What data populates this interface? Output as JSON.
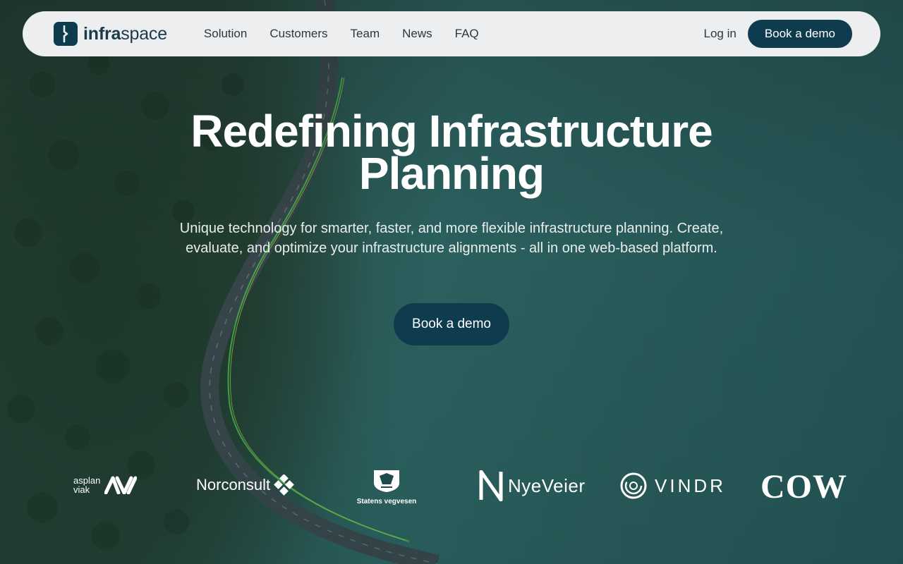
{
  "brand": {
    "name_bold": "infra",
    "name_regular": "space",
    "logo_icon": "infraspace-logo-icon",
    "primary_color": "#0f3b4e",
    "nav_bg": "#eceef0"
  },
  "nav": {
    "links": [
      "Solution",
      "Customers",
      "Team",
      "News",
      "FAQ"
    ],
    "login_label": "Log in",
    "cta_label": "Book a demo"
  },
  "hero": {
    "title_line1": "Redefining Infrastructure",
    "title_line2": "Planning",
    "subtitle": "Unique technology for smarter, faster, and more flexible infrastructure planning. Create, evaluate, and optimize your infrastructure alignments - all in one web-based platform.",
    "cta_label": "Book a demo",
    "background": "aerial-forest-road-lake-image"
  },
  "clients": {
    "asplan_viak": {
      "line1": "asplan",
      "line2": "viak",
      "icon": "asplan-viak-mark"
    },
    "norconsult": {
      "label": "Norconsult",
      "icon": "norconsult-diamond-mark"
    },
    "statens_vegvesen": {
      "label": "Statens vegvesen",
      "icon": "statens-vegvesen-crest"
    },
    "nye_veier": {
      "label": "NyeVeier",
      "icon": "nye-veier-n-mark"
    },
    "vindr": {
      "label": "VINDR",
      "icon": "vindr-circle-mark"
    },
    "cowi": {
      "label": "COWI"
    }
  }
}
